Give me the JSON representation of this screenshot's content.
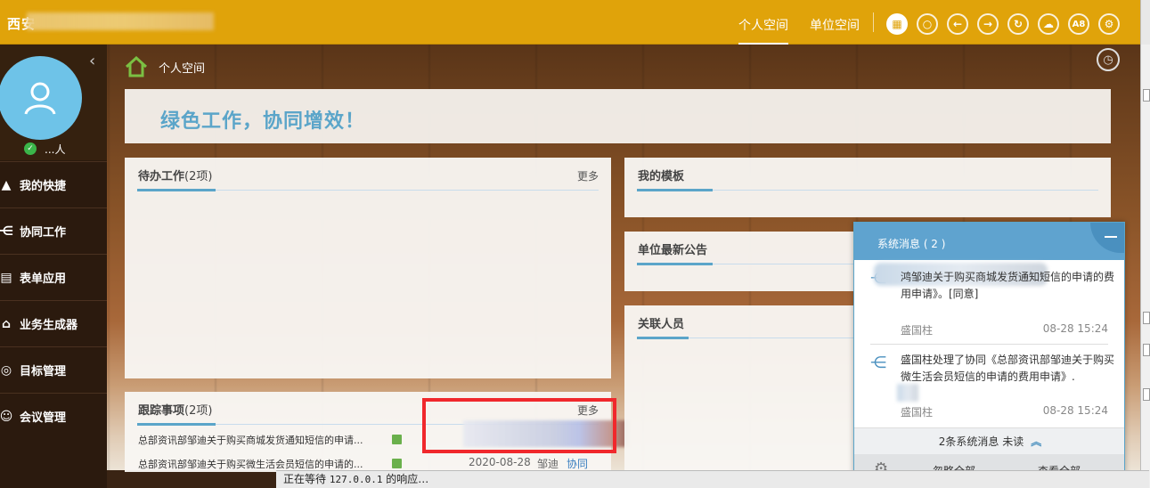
{
  "header": {
    "app_title": "西安",
    "nav": [
      "个人空间",
      "单位空间"
    ],
    "icons": [
      "grid-icon",
      "search-icon",
      "back-icon",
      "forward-icon",
      "refresh-icon",
      "cloud-icon",
      "a8-icon",
      "settings-icon"
    ],
    "a8_label": "A8"
  },
  "user": {
    "name": "...人"
  },
  "sidebar": {
    "items": [
      {
        "label": "我的快捷",
        "icon": "shortcut-icon"
      },
      {
        "label": "协同工作",
        "icon": "collaboration-icon"
      },
      {
        "label": "表单应用",
        "icon": "form-icon"
      },
      {
        "label": "业务生成器",
        "icon": "business-builder-icon"
      },
      {
        "label": "目标管理",
        "icon": "target-icon"
      },
      {
        "label": "会议管理",
        "icon": "meeting-icon"
      }
    ]
  },
  "breadcrumb": {
    "text": "个人空间"
  },
  "slogan": "绿色工作，协同增效！",
  "panels": {
    "todo": {
      "title": "待办工作",
      "count": "(2项)",
      "more": "更多"
    },
    "tracking": {
      "title": "跟踪事项",
      "count": "(2项)",
      "more": "更多",
      "rows": [
        {
          "subject": "总部资讯部邹迪关于购买商城发货通知短信的申请...",
          "date": "",
          "person": "",
          "type": ""
        },
        {
          "subject": "总部资讯部邹迪关于购买微生活会员短信的申请的...",
          "date": "2020-08-28",
          "person": "邹迪",
          "type": "协同"
        }
      ]
    },
    "templates": {
      "title": "我的模板"
    },
    "announcements": {
      "title": "单位最新公告"
    },
    "related": {
      "title": "关联人员"
    }
  },
  "notification": {
    "title": "系统消息 ( 2 )",
    "messages": [
      {
        "text": "鸿邹迪关于购买商城发货通知短信的申请的费用申请》。[同意]",
        "sender": "盛国柱",
        "time": "08-28 15:24"
      },
      {
        "text": "盛国柱处理了协同《总部资讯部邹迪关于购买微生活会员短信的申请的费用申请》.",
        "sender": "盛国柱",
        "time": "08-28 15:24"
      }
    ],
    "footer": "2条系统消息 未读",
    "actions": [
      "忽略全部",
      "查看全部"
    ]
  },
  "status_bar": {
    "prefix": "正在等待",
    "host": "127.0.0.1",
    "suffix": "的响应…"
  },
  "colors": {
    "topbar": "#e0a30a",
    "accent": "#5ba5c9",
    "highlight_box": "#f0282c"
  }
}
